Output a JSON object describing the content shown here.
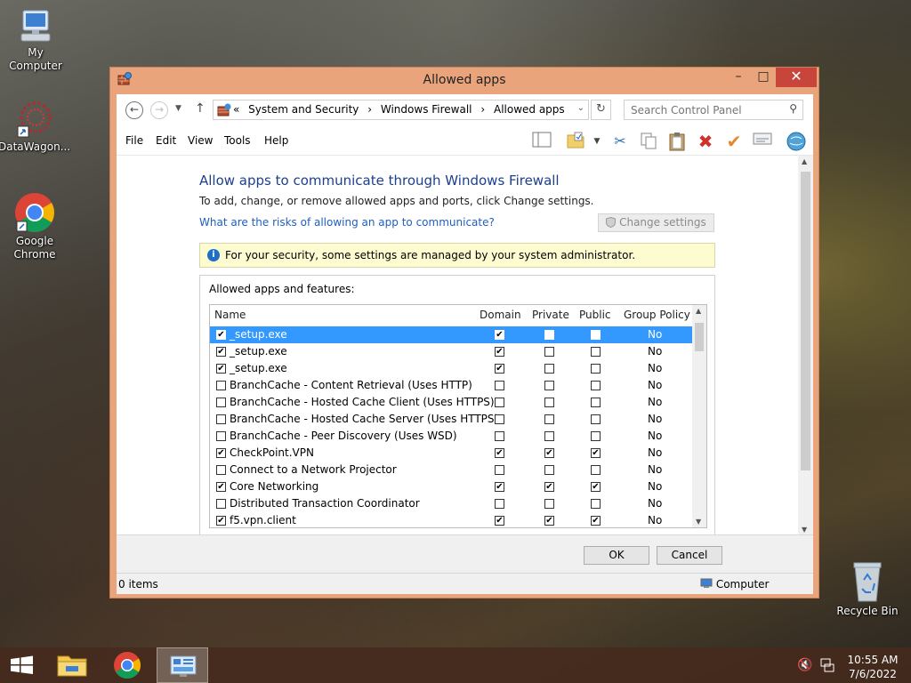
{
  "desktop": {
    "icons": [
      {
        "label": "My Computer"
      },
      {
        "label": "DataWagon..."
      },
      {
        "label": "Google Chrome"
      },
      {
        "label": "Recycle Bin"
      }
    ]
  },
  "window": {
    "title": "Allowed apps",
    "controls": {
      "minimize": "–",
      "maximize": "□",
      "close": "✕"
    }
  },
  "address": {
    "prefix": "«",
    "crumbs": [
      "System and Security",
      "Windows Firewall",
      "Allowed apps"
    ],
    "separator": "›"
  },
  "search": {
    "placeholder": "Search Control Panel"
  },
  "menu": [
    "File",
    "Edit",
    "View",
    "Tools",
    "Help"
  ],
  "toolbar_icons": [
    "layout-icon",
    "open-folder-icon",
    "dropdown-icon",
    "cut-icon",
    "copy-icon",
    "paste-icon",
    "delete-icon",
    "checkmark-icon",
    "properties-icon",
    "globe-icon"
  ],
  "content": {
    "heading": "Allow apps to communicate through Windows Firewall",
    "description": "To add, change, or remove allowed apps and ports, click Change settings.",
    "risk_link": "What are the risks of allowing an app to communicate?",
    "change_settings": "Change settings",
    "info": "For your security, some settings are managed by your system administrator.",
    "list_label": "Allowed apps and features:"
  },
  "table": {
    "columns": [
      "Name",
      "Domain",
      "Private",
      "Public",
      "Group Policy"
    ],
    "rows": [
      {
        "enabled": true,
        "name": "_setup.exe",
        "domain": true,
        "private": false,
        "public": false,
        "gp": "No",
        "selected": true
      },
      {
        "enabled": true,
        "name": "_setup.exe",
        "domain": true,
        "private": false,
        "public": false,
        "gp": "No"
      },
      {
        "enabled": true,
        "name": "_setup.exe",
        "domain": true,
        "private": false,
        "public": false,
        "gp": "No"
      },
      {
        "enabled": false,
        "name": "BranchCache - Content Retrieval (Uses HTTP)",
        "domain": false,
        "private": false,
        "public": false,
        "gp": "No"
      },
      {
        "enabled": false,
        "name": "BranchCache - Hosted Cache Client (Uses HTTPS)",
        "domain": false,
        "private": false,
        "public": false,
        "gp": "No"
      },
      {
        "enabled": false,
        "name": "BranchCache - Hosted Cache Server (Uses HTTPS)",
        "domain": false,
        "private": false,
        "public": false,
        "gp": "No"
      },
      {
        "enabled": false,
        "name": "BranchCache - Peer Discovery (Uses WSD)",
        "domain": false,
        "private": false,
        "public": false,
        "gp": "No"
      },
      {
        "enabled": true,
        "name": "CheckPoint.VPN",
        "domain": true,
        "private": true,
        "public": true,
        "gp": "No"
      },
      {
        "enabled": false,
        "name": "Connect to a Network Projector",
        "domain": false,
        "private": false,
        "public": false,
        "gp": "No"
      },
      {
        "enabled": true,
        "name": "Core Networking",
        "domain": true,
        "private": true,
        "public": true,
        "gp": "No"
      },
      {
        "enabled": false,
        "name": "Distributed Transaction Coordinator",
        "domain": false,
        "private": false,
        "public": false,
        "gp": "No"
      },
      {
        "enabled": true,
        "name": "f5.vpn.client",
        "domain": true,
        "private": true,
        "public": true,
        "gp": "No"
      }
    ]
  },
  "buttons": {
    "ok": "OK",
    "cancel": "Cancel"
  },
  "status": {
    "items": "0 items",
    "location": "Computer"
  },
  "taskbar": {
    "time": "10:55 AM",
    "date": "7/6/2022"
  },
  "colors": {
    "titlebar": "#e9a47c",
    "close": "#c7453b",
    "heading": "#1c3f8f",
    "link": "#1f5fbf",
    "selection": "#3399ff"
  }
}
